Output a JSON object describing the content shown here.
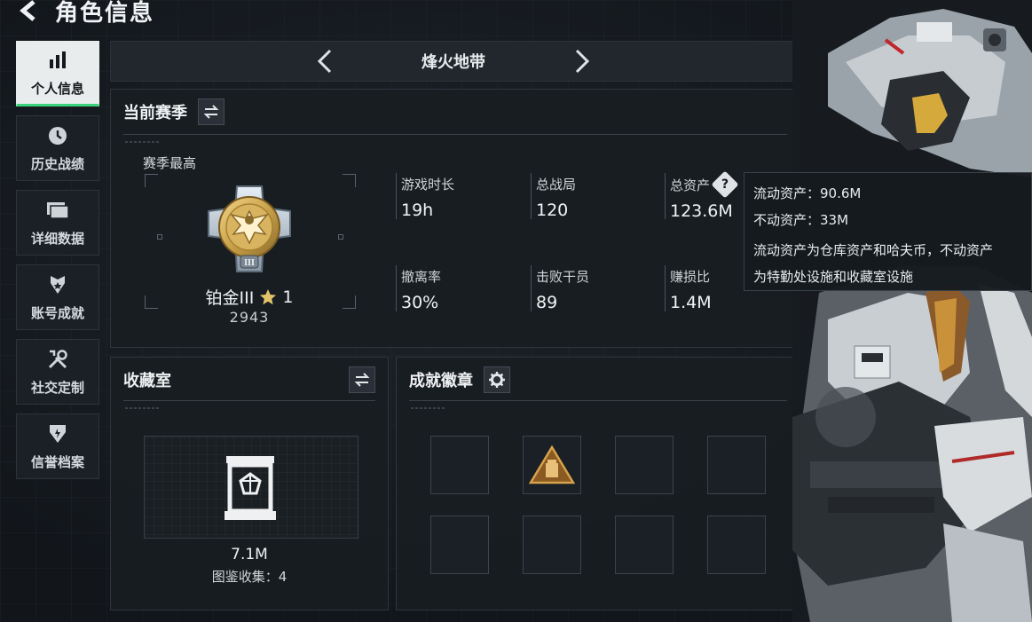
{
  "header": {
    "title": "角色信息",
    "back_icon": "back-arrow-icon"
  },
  "sidebar": {
    "items": [
      {
        "label": "个人信息",
        "icon": "bar-chart-icon",
        "active": true
      },
      {
        "label": "历史战绩",
        "icon": "clock-icon",
        "active": false
      },
      {
        "label": "详细数据",
        "icon": "folder-icon",
        "active": false
      },
      {
        "label": "账号成就",
        "icon": "medal-icon",
        "active": false
      },
      {
        "label": "社交定制",
        "icon": "tools-icon",
        "active": false
      },
      {
        "label": "信誉档案",
        "icon": "shield-icon",
        "active": false
      }
    ]
  },
  "mode": {
    "title": "烽火地带"
  },
  "season": {
    "title": "当前赛季",
    "best_label": "赛季最高",
    "rank_name": "铂金III",
    "rank_stars": "1",
    "rank_score": "2943",
    "stats": [
      {
        "label": "游戏时长",
        "value": "19h"
      },
      {
        "label": "总战局",
        "value": "120"
      },
      {
        "label": "总资产",
        "value": "123.6M"
      },
      {
        "label": "撤离率",
        "value": "30%"
      },
      {
        "label": "击败干员",
        "value": "89"
      },
      {
        "label": "赚损比",
        "value": "1.4M"
      }
    ]
  },
  "tooltip": {
    "line1": "流动资产：90.6M",
    "line2": "不动资产：33M",
    "line3": "流动资产为仓库资产和哈夫币，不动资产",
    "line4": "为特勤处设施和收藏室设施"
  },
  "collection": {
    "title": "收藏室",
    "value": "7.1M",
    "count_label": "图鉴收集：4"
  },
  "achievements": {
    "title": "成就徽章"
  },
  "colors": {
    "accent_green": "#3ad27a",
    "gold": "#c9a24a",
    "panel_bg": "#181d22"
  }
}
